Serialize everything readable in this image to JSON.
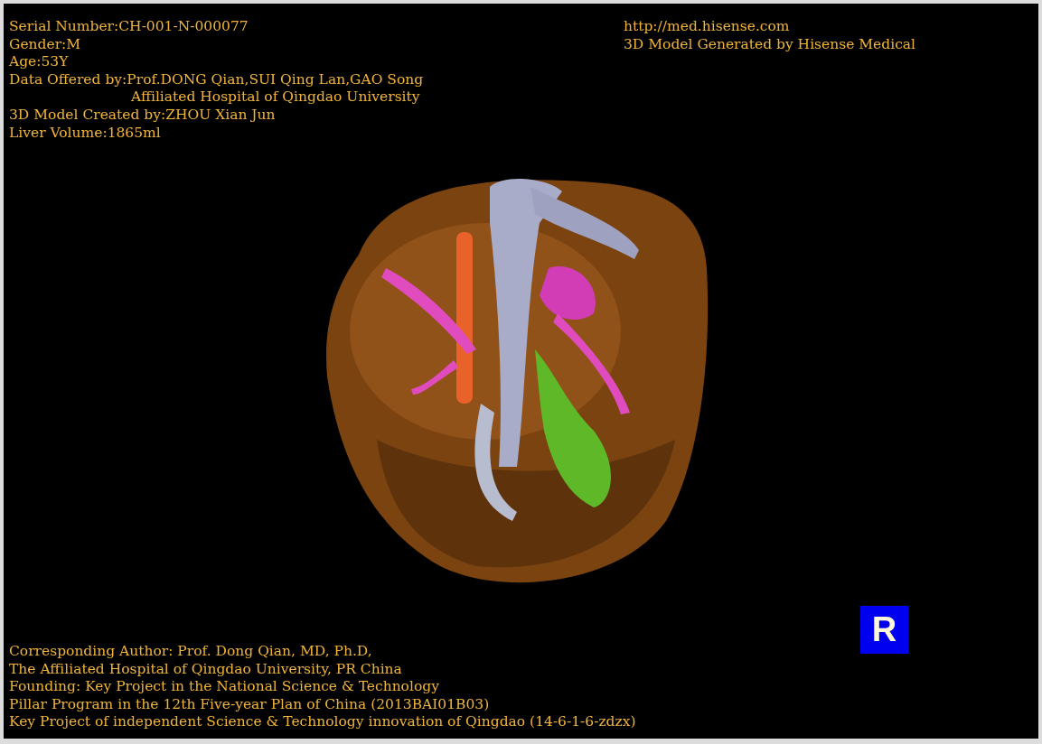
{
  "header_left": {
    "lines": [
      {
        "text": "Serial Number:CH-001-N-000077",
        "kind": "plain"
      },
      {
        "text": "Gender:M",
        "kind": "plain"
      },
      {
        "text": "Age:53Y",
        "kind": "plain"
      },
      {
        "text": "Data Offered by:Prof.DONG Qian,SUI Qing Lan,GAO Song",
        "kind": "plain"
      },
      {
        "text": "Affiliated Hospital of Qingdao University",
        "kind": "indented"
      },
      {
        "text": "3D Model Created by:ZHOU Xian Jun",
        "kind": "plain"
      },
      {
        "text": "Liver Volume:1865ml",
        "kind": "plain"
      }
    ]
  },
  "header_right": {
    "link": "http://med.hisense.com",
    "credit": "3D Model Generated by Hisense Medical"
  },
  "view": {
    "kind": "picture",
    "orientation_badge": "R"
  },
  "footer": {
    "lines": [
      "Corresponding Author: Prof. Dong Qian, MD, Ph.D,",
      "The Affiliated Hospital of Qingdao University, PR China",
      "Founding: Key Project in the National Science & Technology",
      "Pillar Program in the 12th Five-year Plan of China (2013BAI01B03)",
      "Key Project of independent Science & Technology innovation of Qingdao (14-6-1-6-zdzx)"
    ]
  }
}
